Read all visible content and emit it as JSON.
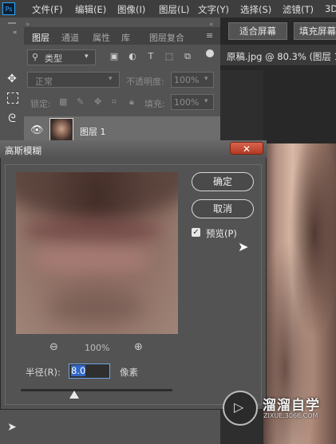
{
  "menu": {
    "logo": "Ps",
    "items": [
      "文件(F)",
      "编辑(E)",
      "图像(I)",
      "图层(L)",
      "文字(Y)",
      "选择(S)",
      "滤镜(T)",
      "3D"
    ]
  },
  "layers_panel": {
    "tabs": [
      "图层",
      "通道",
      "属性",
      "库",
      "图层复合"
    ],
    "filter_label": "类型",
    "blend_mode": "正常",
    "opacity_label": "不透明度:",
    "opacity_value": "100%",
    "lock_label": "锁定:",
    "fill_label": "填充:",
    "fill_value": "100%",
    "layer_name": "图层 1"
  },
  "options_bar": {
    "fit_screen": "适合屏幕",
    "fill_screen": "填充屏幕"
  },
  "document_tab": "原稿.jpg @ 80.3% (图层 1",
  "dialog": {
    "title": "高斯模糊",
    "close_glyph": "✕",
    "ok_label": "确定",
    "cancel_label": "取消",
    "preview_label": "预览(P)",
    "preview_checked": true,
    "zoom_level": "100%",
    "radius_label": "半径(R):",
    "radius_value": "8.0",
    "radius_unit": "像素",
    "slider_fraction": 0.35
  },
  "watermark": {
    "name": "溜溜自学",
    "url": "ZIXUE.3066.COM"
  },
  "colors": {
    "accent": "#31a8ff",
    "close_button": "#c4462e",
    "selection": "#2f67c6"
  }
}
